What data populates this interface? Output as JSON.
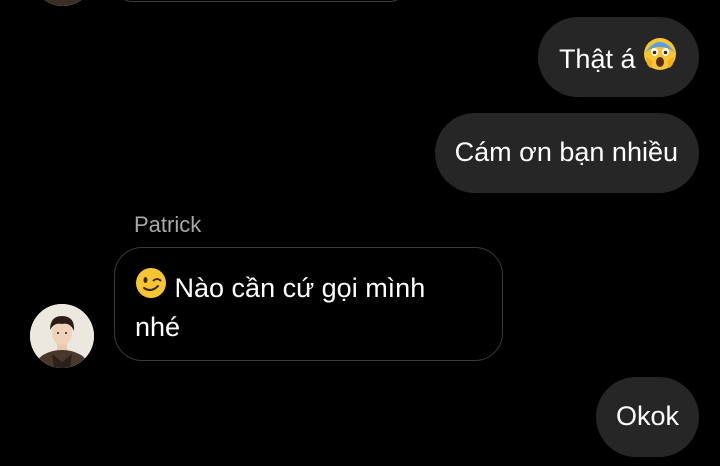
{
  "messages": {
    "m1": {
      "text": "Thật á",
      "emoji": "face-screaming-in-fear"
    },
    "m2": {
      "text": "Cám ơn bạn nhiều"
    },
    "sender": {
      "name": "Patrick"
    },
    "m3": {
      "line1": "Nào cần cứ gọi mình",
      "line2": "nhé",
      "emoji": "winking-face"
    },
    "m4": {
      "text": "Okok"
    }
  },
  "colors": {
    "background": "#000000",
    "outgoing_bubble": "#262626",
    "incoming_border": "#3a3a3a",
    "sender_name": "#a8a8a8",
    "text": "#ffffff"
  }
}
